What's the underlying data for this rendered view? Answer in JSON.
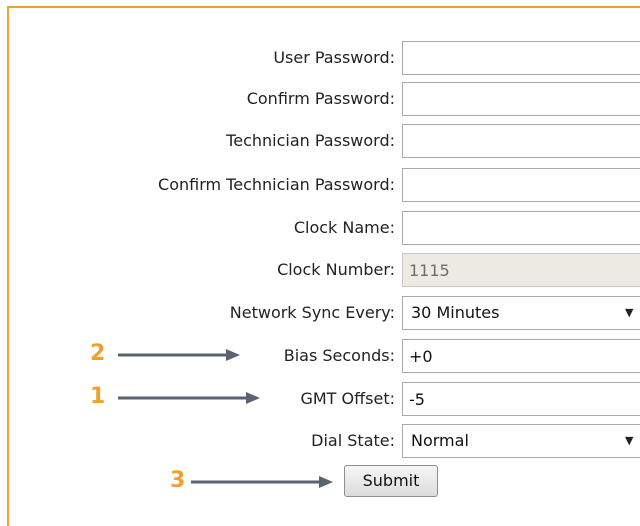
{
  "form": {
    "user_password": {
      "label": "User Password:",
      "value": ""
    },
    "confirm_password": {
      "label": "Confirm Password:",
      "value": ""
    },
    "technician_password": {
      "label": "Technician Password:",
      "value": ""
    },
    "confirm_technician_password": {
      "label": "Confirm Technician Password:",
      "value": ""
    },
    "clock_name": {
      "label": "Clock Name:",
      "value": ""
    },
    "clock_number": {
      "label": "Clock Number:",
      "value": "1115"
    },
    "network_sync": {
      "label": "Network Sync Every:",
      "selected": "30 Minutes"
    },
    "bias_seconds": {
      "label": "Bias Seconds:",
      "value": "+0"
    },
    "gmt_offset": {
      "label": "GMT Offset:",
      "value": "-5"
    },
    "dial_state": {
      "label": "Dial State:",
      "selected": "Normal"
    },
    "submit_label": "Submit"
  },
  "annotations": {
    "bias_seconds_number": "2",
    "gmt_offset_number": "1",
    "submit_number": "3",
    "color": "#f0a030"
  },
  "colors": {
    "frame_border": "#f0a030",
    "arrow": "#5a6470"
  }
}
